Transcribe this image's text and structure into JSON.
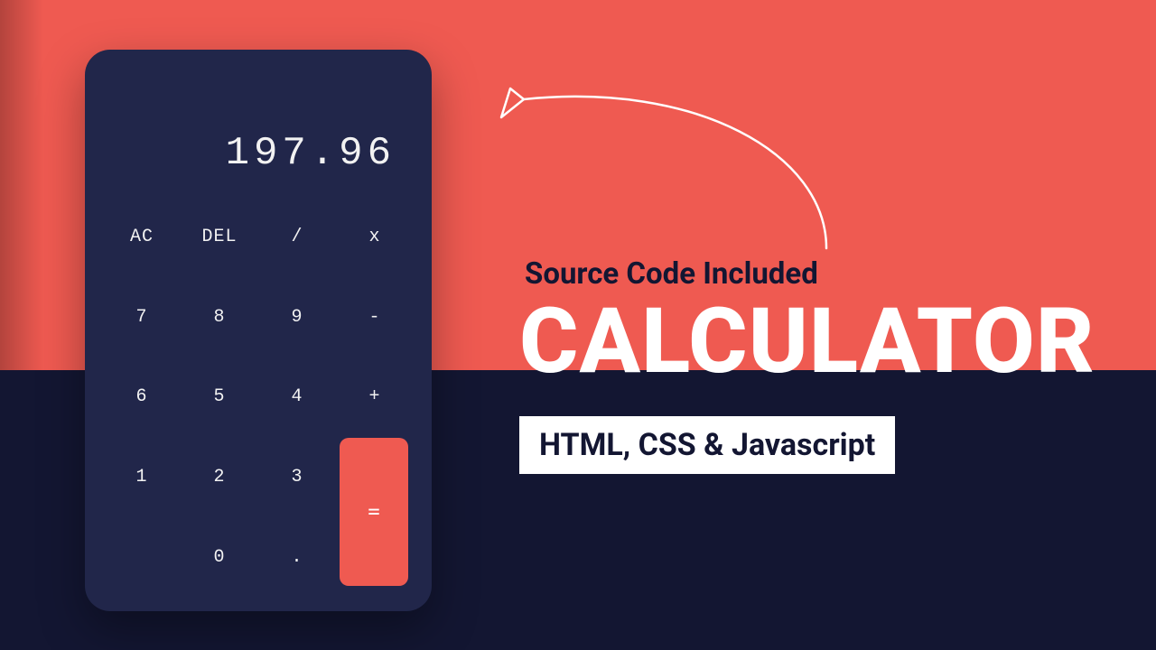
{
  "calculator": {
    "display": "197.96",
    "keys": {
      "ac": "AC",
      "del": "DEL",
      "divide": "/",
      "multiply": "x",
      "seven": "7",
      "eight": "8",
      "nine": "9",
      "minus": "-",
      "six": "6",
      "five": "5",
      "four": "4",
      "plus": "+",
      "one": "1",
      "two": "2",
      "three": "3",
      "zero": "0",
      "dot": ".",
      "equals": "="
    }
  },
  "promo": {
    "subtitle": "Source Code Included",
    "title": "CALCULATOR",
    "badge": "HTML, CSS & Javascript"
  }
}
